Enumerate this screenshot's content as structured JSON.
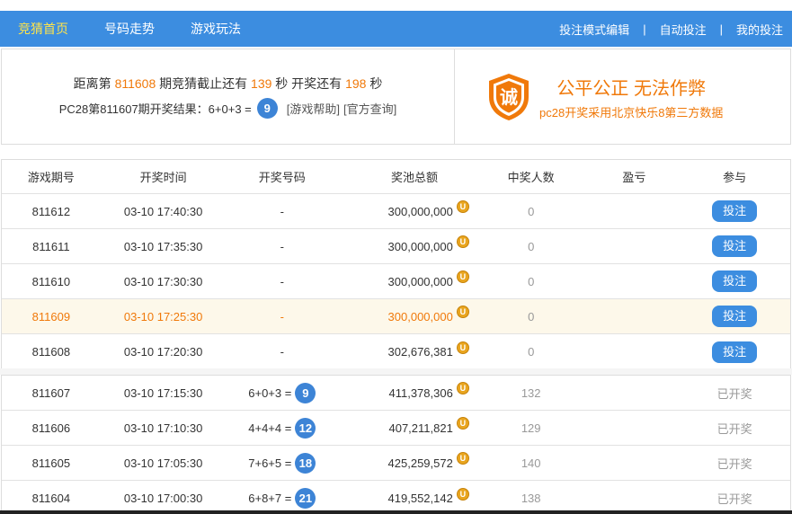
{
  "nav": {
    "left": [
      {
        "label": "竞猜首页",
        "active": true
      },
      {
        "label": "号码走势",
        "active": false
      },
      {
        "label": "游戏玩法",
        "active": false
      }
    ],
    "right": [
      {
        "label": "投注模式编辑"
      },
      {
        "label": "自动投注"
      },
      {
        "label": "我的投注"
      }
    ],
    "separator": "|"
  },
  "info": {
    "prefix1": "距离第",
    "period": "811608",
    "mid1": "期竞猜截止还有",
    "countdown1": "139",
    "mid2": "秒 开奖还有",
    "countdown2": "198",
    "suffix1": "秒",
    "result_prefix": "PC28第811607期开奖结果：6+0+3 =",
    "result_value": "9",
    "help_link": "[游戏帮助]",
    "official_link": "[官方查询]"
  },
  "fair": {
    "badge": "诚",
    "title": "公平公正 无法作弊",
    "subtitle": "pc28开奖采用北京快乐8第三方数据"
  },
  "colors": {
    "nav_bg": "#3c8de0",
    "nav_active": "#ffe44a",
    "accent_orange": "#f0790a",
    "ball_blue": "#3d84d6",
    "coin_gold": "#e9a51f"
  },
  "table": {
    "headers": [
      "游戏期号",
      "开奖时间",
      "开奖号码",
      "奖池总额",
      "中奖人数",
      "盈亏",
      "参与"
    ],
    "coin_symbol": "U",
    "upcoming": [
      {
        "id": "811612",
        "time": "03-10 17:40:30",
        "numbers": "-",
        "pool": "300,000,000",
        "winners": "0",
        "profit": "",
        "action": "投注"
      },
      {
        "id": "811611",
        "time": "03-10 17:35:30",
        "numbers": "-",
        "pool": "300,000,000",
        "winners": "0",
        "profit": "",
        "action": "投注"
      },
      {
        "id": "811610",
        "time": "03-10 17:30:30",
        "numbers": "-",
        "pool": "300,000,000",
        "winners": "0",
        "profit": "",
        "action": "投注"
      },
      {
        "id": "811609",
        "time": "03-10 17:25:30",
        "numbers": "-",
        "pool": "300,000,000",
        "winners": "0",
        "profit": "",
        "action": "投注"
      },
      {
        "id": "811608",
        "time": "03-10 17:20:30",
        "numbers": "-",
        "pool": "302,676,381",
        "winners": "0",
        "profit": "",
        "action": "投注"
      }
    ],
    "past": [
      {
        "id": "811607",
        "time": "03-10 17:15:30",
        "numbers": "6+0+3 =",
        "result": "9",
        "pool": "411,378,306",
        "winners": "132",
        "profit": "",
        "status": "已开奖"
      },
      {
        "id": "811606",
        "time": "03-10 17:10:30",
        "numbers": "4+4+4 =",
        "result": "12",
        "pool": "407,211,821",
        "winners": "129",
        "profit": "",
        "status": "已开奖"
      },
      {
        "id": "811605",
        "time": "03-10 17:05:30",
        "numbers": "7+6+5 =",
        "result": "18",
        "pool": "425,259,572",
        "winners": "140",
        "profit": "",
        "status": "已开奖"
      },
      {
        "id": "811604",
        "time": "03-10 17:00:30",
        "numbers": "6+8+7 =",
        "result": "21",
        "pool": "419,552,142",
        "winners": "138",
        "profit": "",
        "status": "已开奖"
      }
    ]
  }
}
